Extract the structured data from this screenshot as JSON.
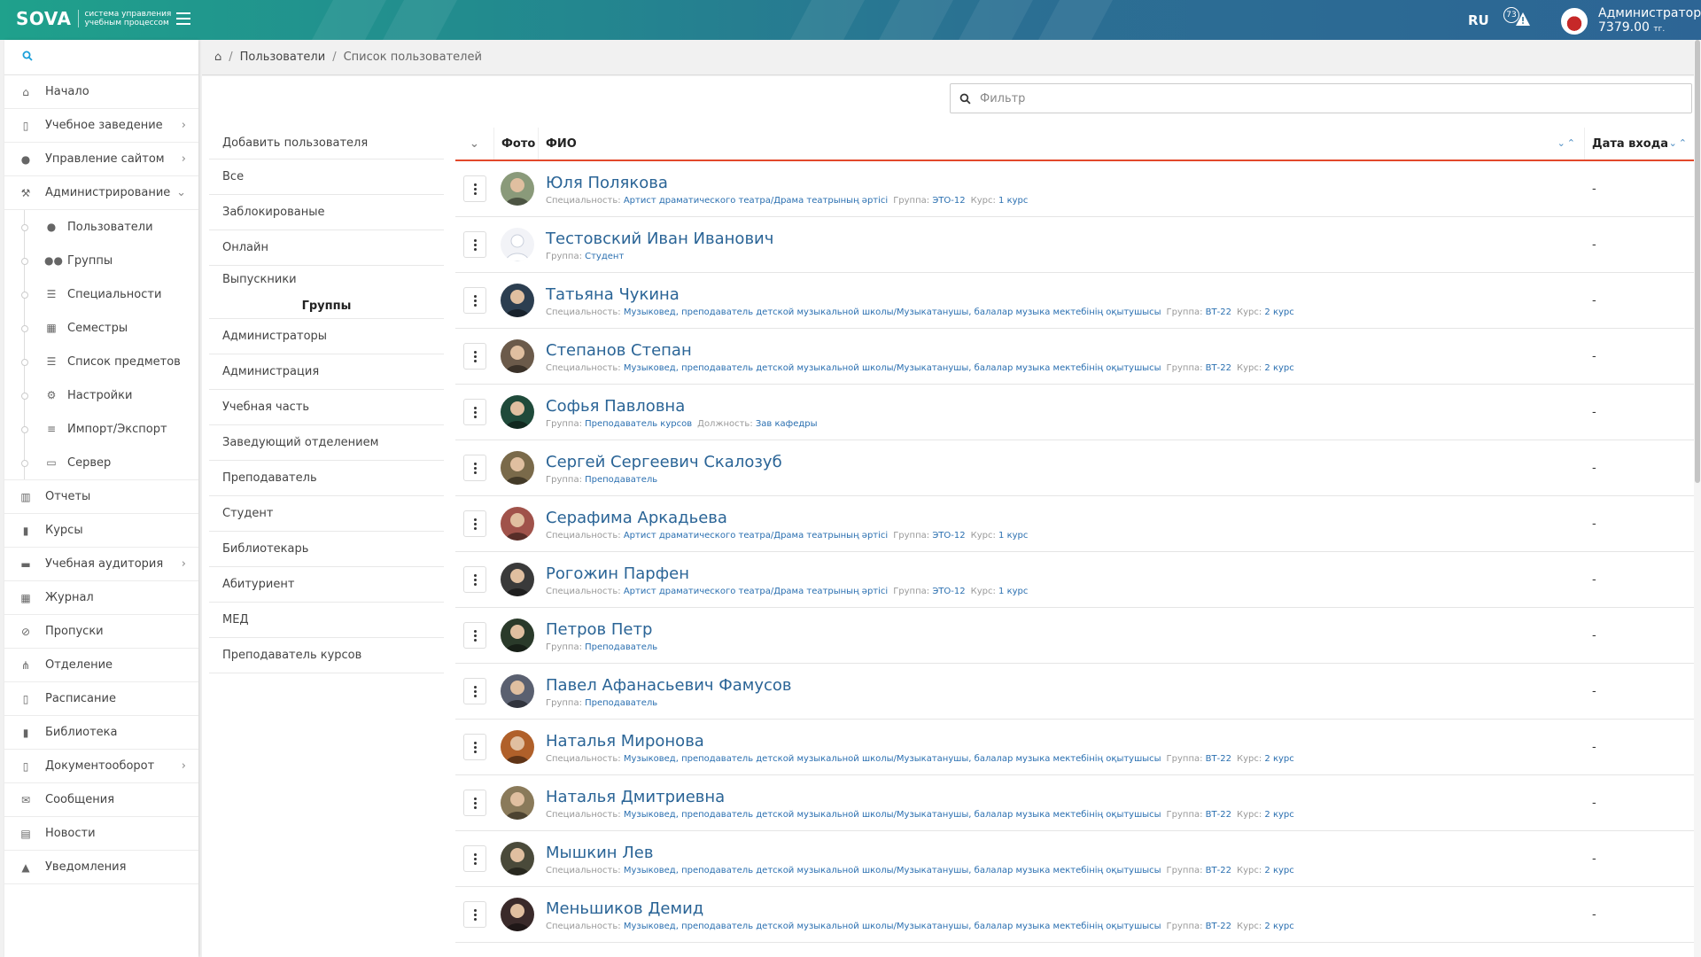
{
  "header": {
    "logo_text": "SOVA",
    "logo_sub_line1": "система управления",
    "logo_sub_line2": "учебным процессом",
    "lang": "RU",
    "alert_count": "73",
    "user_name": "Администратор",
    "user_balance": "7379.00",
    "user_currency": "тг."
  },
  "sidebar": {
    "items": [
      {
        "label": "Начало",
        "icon": "home-icon"
      },
      {
        "label": "Учебное заведение",
        "icon": "building-icon",
        "has_children": true
      },
      {
        "label": "Управление сайтом",
        "icon": "globe-icon",
        "has_children": true
      },
      {
        "label": "Администрирование",
        "icon": "gavel-icon",
        "has_children": true,
        "expanded": true
      }
    ],
    "sub_items": [
      {
        "label": "Пользователи",
        "icon": "user-icon"
      },
      {
        "label": "Группы",
        "icon": "users-icon"
      },
      {
        "label": "Специальности",
        "icon": "list-alt-icon"
      },
      {
        "label": "Семестры",
        "icon": "calendar-icon"
      },
      {
        "label": "Список предметов",
        "icon": "list-icon"
      },
      {
        "label": "Настройки",
        "icon": "cogs-icon"
      },
      {
        "label": "Импорт/Экспорт",
        "icon": "database-icon"
      },
      {
        "label": "Сервер",
        "icon": "laptop-icon"
      }
    ],
    "items_after": [
      {
        "label": "Отчеты",
        "icon": "bar-chart-icon"
      },
      {
        "label": "Курсы",
        "icon": "book-icon"
      },
      {
        "label": "Учебная аудитория",
        "icon": "presentation-icon",
        "has_children": true
      },
      {
        "label": "Журнал",
        "icon": "table-icon"
      },
      {
        "label": "Пропуски",
        "icon": "ban-icon"
      },
      {
        "label": "Отделение",
        "icon": "sitemap-icon"
      },
      {
        "label": "Расписание",
        "icon": "columns-icon"
      },
      {
        "label": "Библиотека",
        "icon": "book-icon"
      },
      {
        "label": "Документооборот",
        "icon": "file-icon",
        "has_children": true
      },
      {
        "label": "Сообщения",
        "icon": "envelope-icon"
      },
      {
        "label": "Новости",
        "icon": "newspaper-icon"
      },
      {
        "label": "Уведомления",
        "icon": "warning-icon"
      }
    ]
  },
  "breadcrumb": {
    "level1": "Пользователи",
    "current": "Список пользователей"
  },
  "filter": {
    "placeholder": "Фильтр"
  },
  "left_menu": {
    "top": [
      "Добавить пользователя",
      "Все",
      "Заблокированые",
      "Онлайн",
      "Выпускники"
    ],
    "groups_heading": "Группы",
    "groups": [
      "Администраторы",
      "Администрация",
      "Учебная часть",
      "Заведующий отделением",
      "Преподаватель",
      "Студент",
      "Библиотекарь",
      "Абитуриент",
      "МЕД",
      "Преподаватель курсов"
    ]
  },
  "table": {
    "col_photo": "Фото",
    "col_name": "ФИО",
    "col_date": "Дата входа",
    "labels": {
      "spec": "Специальность:",
      "group": "Группа:",
      "course": "Курс:",
      "position": "Должность:"
    },
    "rows": [
      {
        "name": "Юля Полякова",
        "spec": "Артист драматического театра/Драма театрының әртісі",
        "group": "ЭТО-12",
        "course": "1 курс",
        "date": "-",
        "photo_color": "#8a9a7a"
      },
      {
        "name": "Тестовский Иван Иванович",
        "group": "Студент",
        "date": "-",
        "photo_color": "#d8dbe3",
        "placeholder": true
      },
      {
        "name": "Татьяна Чукина",
        "spec": "Музыковед, преподаватель детской музыкальной школы/Музыкатанушы, балалар музыка мектебінің оқытушысы",
        "group": "ВТ-22",
        "course": "2 курс",
        "date": "-",
        "photo_color": "#2c3e50"
      },
      {
        "name": "Степанов Степан",
        "spec": "Музыковед, преподаватель детской музыкальной школы/Музыкатанушы, балалар музыка мектебінің оқытушысы",
        "group": "ВТ-22",
        "course": "2 курс",
        "date": "-",
        "photo_color": "#6b5a4a"
      },
      {
        "name": "Софья Павловна",
        "group": "Преподаватель курсов",
        "position": "Зав кафедры",
        "date": "-",
        "photo_color": "#1f4a3a"
      },
      {
        "name": "Сергей Сергеевич Скалозуб",
        "group": "Преподаватель",
        "date": "-",
        "photo_color": "#7a6a4a"
      },
      {
        "name": "Серафима Аркадьева",
        "spec": "Артист драматического театра/Драма театрының әртісі",
        "group": "ЭТО-12",
        "course": "1 курс",
        "date": "-",
        "photo_color": "#a0524a"
      },
      {
        "name": "Рогожин Парфен",
        "spec": "Артист драматического театра/Драма театрының әртісі",
        "group": "ЭТО-12",
        "course": "1 курс",
        "date": "-",
        "photo_color": "#3a3a3a"
      },
      {
        "name": "Петров Петр",
        "group": "Преподаватель",
        "date": "-",
        "photo_color": "#2a3a2a"
      },
      {
        "name": "Павел Афанасьевич Фамусов",
        "group": "Преподаватель",
        "date": "-",
        "photo_color": "#5a6070"
      },
      {
        "name": "Наталья Миронова",
        "spec": "Музыковед, преподаватель детской музыкальной школы/Музыкатанушы, балалар музыка мектебінің оқытушысы",
        "group": "ВТ-22",
        "course": "2 курс",
        "date": "-",
        "photo_color": "#b0602a"
      },
      {
        "name": "Наталья Дмитриевна",
        "spec": "Музыковед, преподаватель детской музыкальной школы/Музыкатанушы, балалар музыка мектебінің оқытушысы",
        "group": "ВТ-22",
        "course": "2 курс",
        "date": "-",
        "photo_color": "#8a7a5a"
      },
      {
        "name": "Мышкин Лев",
        "spec": "Музыковед, преподаватель детской музыкальной школы/Музыкатанушы, балалар музыка мектебінің оқытушысы",
        "group": "ВТ-22",
        "course": "2 курс",
        "date": "-",
        "photo_color": "#4a4a3a"
      },
      {
        "name": "Меньшиков Демид",
        "spec": "Музыковед, преподаватель детской музыкальной школы/Музыкатанушы, балалар музыка мектебінің оқытушысы",
        "group": "ВТ-22",
        "course": "2 курс",
        "date": "-",
        "photo_color": "#3a2a2a"
      }
    ]
  }
}
